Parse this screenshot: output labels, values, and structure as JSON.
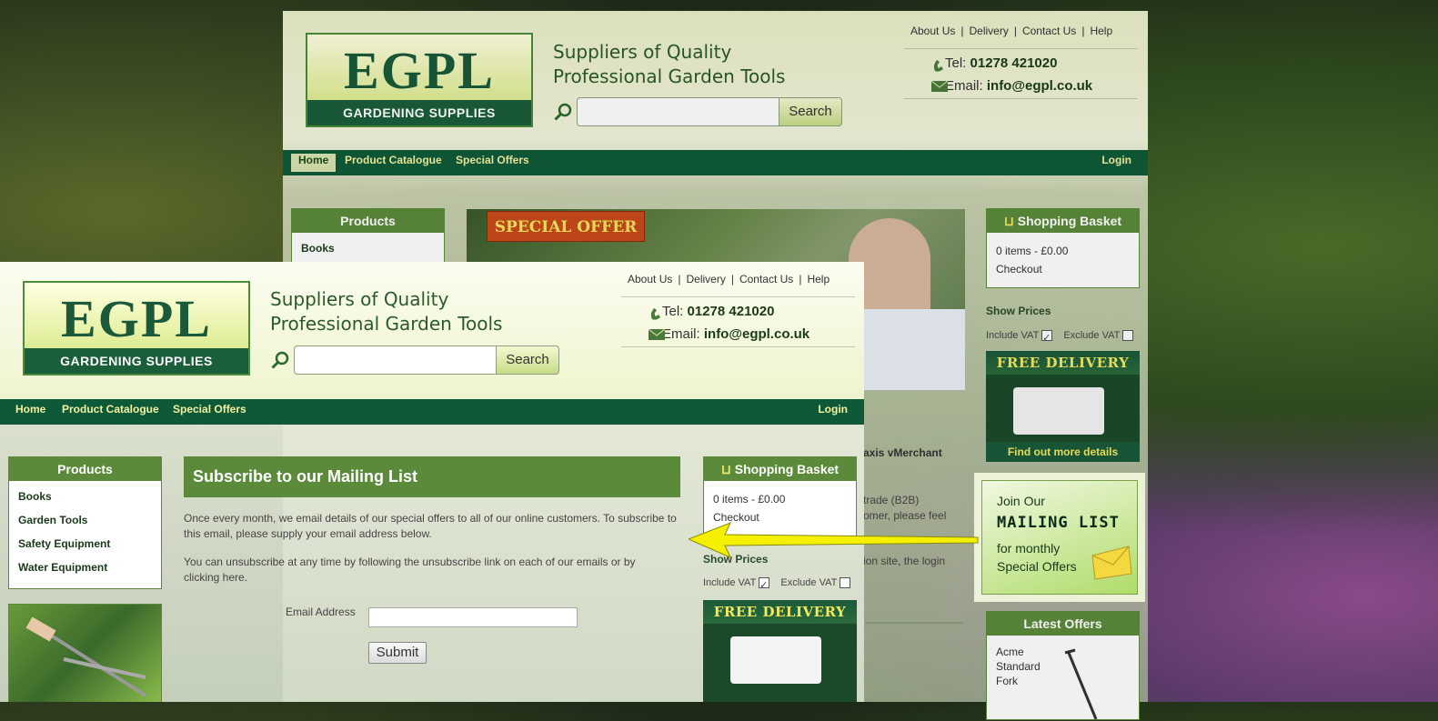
{
  "back": {
    "logo": {
      "main": "EGPL",
      "sub": "GARDENING SUPPLIES"
    },
    "tagline": [
      "Suppliers of Quality",
      "Professional Garden Tools"
    ],
    "search_button": "Search",
    "toplinks": [
      "About Us",
      "Delivery",
      "Contact Us",
      "Help"
    ],
    "tel_label": "Tel:",
    "tel": "01278 421020",
    "email_label": "Email:",
    "email": "info@egpl.co.uk",
    "nav": [
      "Home",
      "Product Catalogue",
      "Special Offers"
    ],
    "login": "Login",
    "products_title": "Products",
    "products_first": "Books",
    "banner_label": "SPECIAL OFFER",
    "basket_title": "Shopping Basket",
    "basket_items": "0 items - £0.00",
    "checkout": "Checkout",
    "show_prices": "Show Prices",
    "inc_vat": "Include VAT",
    "exc_vat": "Exclude VAT",
    "free_delivery": "FREE DELIVERY",
    "find_out": "Find out more details",
    "mailing": {
      "line1": "Join Our",
      "line2": "MAILING LIST",
      "line3": "for monthly",
      "line4": "Special Offers"
    },
    "latest_offers": "Latest Offers",
    "offer": [
      "Acme",
      "Standard",
      "Fork"
    ],
    "partial_text": [
      "axis vMerchant",
      "trade (B2B)",
      "omer, please feel",
      "ion site, the login"
    ]
  },
  "front": {
    "logo": {
      "main": "EGPL",
      "sub": "GARDENING SUPPLIES"
    },
    "tagline": [
      "Suppliers of Quality",
      "Professional Garden Tools"
    ],
    "search_button": "Search",
    "toplinks": [
      "About Us",
      "Delivery",
      "Contact Us",
      "Help"
    ],
    "tel_label": "Tel:",
    "tel": "01278 421020",
    "email_label": "Email:",
    "email": "info@egpl.co.uk",
    "nav": [
      "Home",
      "Product Catalogue",
      "Special Offers"
    ],
    "login": "Login",
    "products_title": "Products",
    "products": [
      "Books",
      "Garden Tools",
      "Safety Equipment",
      "Water Equipment"
    ],
    "subscribe_title": "Subscribe to our Mailing List",
    "para1": "Once every month, we email details of our special offers to all of our online customers. To subscribe to this email, please supply your email address below.",
    "para2": "You can unsubscribe at any time by following the unsubscribe link on each of our emails or by clicking here.",
    "email_field_label": "Email Address",
    "submit": "Submit",
    "basket_title": "Shopping Basket",
    "basket_items": "0 items - £0.00",
    "checkout": "Checkout",
    "show_prices": "Show Prices",
    "inc_vat": "Include VAT",
    "exc_vat": "Exclude VAT",
    "free_delivery": "FREE DELIVERY"
  },
  "colors": {
    "brand_green": "#0e5a38",
    "accent_green": "#5a8a3a",
    "arrow": "#f4f000"
  }
}
